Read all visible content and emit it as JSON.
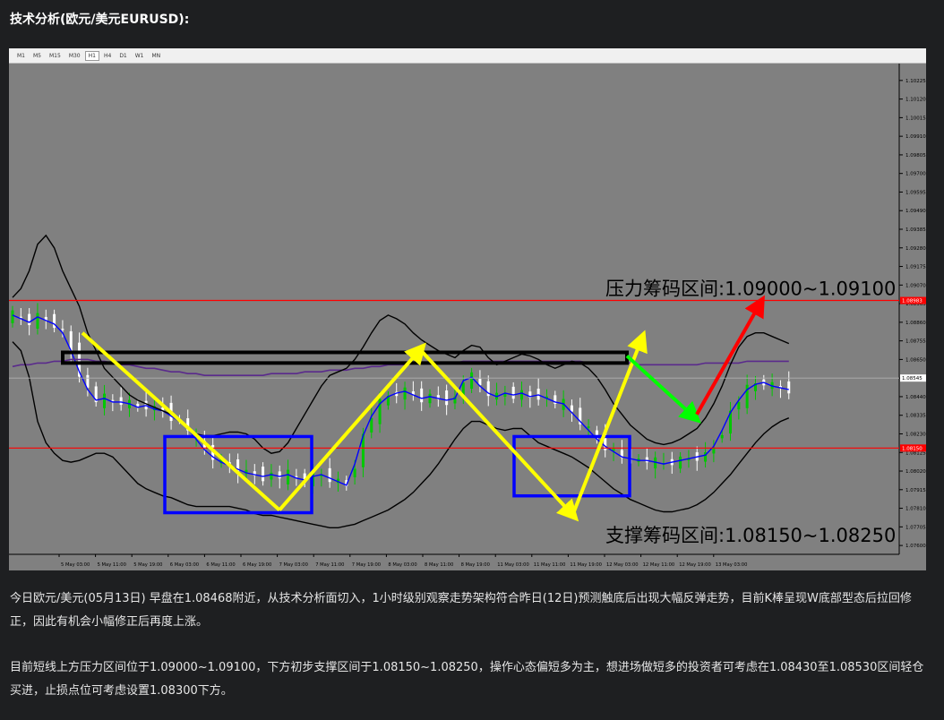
{
  "heading": "技术分析(欧元/美元EURUSD):",
  "timeframes": [
    "M1",
    "M5",
    "M15",
    "M30",
    "H1",
    "H4",
    "D1",
    "W1",
    "MN"
  ],
  "active_timeframe": "H1",
  "paragraphs": [
    "今日欧元/美元(05月13日) 早盘在1.08468附近，从技术分析面切入，1小时级别观察走势架构符合昨日(12日)预测触底后出现大幅反弹走势，目前K棒呈现W底部型态后拉回修正，因此有机会小幅修正后再度上涨。",
    "目前短线上方压力区间位于1.09000~1.09100，下方初步支撑区间于1.08150~1.08250，操作心态偏短多为主，想进场做短多的投资者可考虑在1.08430至1.08530区间轻仓买进，止损点位可考虑设置1.08300下方。"
  ],
  "chart_data": {
    "type": "line",
    "instrument": "EURUSD",
    "timeframe": "H1",
    "ylim": [
      1.0755,
      1.103
    ],
    "y_ticks": [
      "1.10225",
      "1.10120",
      "1.10015",
      "1.09910",
      "1.09805",
      "1.09700",
      "1.09595",
      "1.09490",
      "1.09385",
      "1.09280",
      "1.09175",
      "1.09070",
      "1.08965",
      "1.08860",
      "1.08755",
      "1.08650",
      "1.08545",
      "1.08440",
      "1.08335",
      "1.08230",
      "1.08125",
      "1.08020",
      "1.07915",
      "1.07810",
      "1.07705",
      "1.07600"
    ],
    "x_ticks": [
      "5 May 03:00",
      "5 May 11:00",
      "5 May 19:00",
      "6 May 03:00",
      "6 May 11:00",
      "6 May 19:00",
      "7 May 03:00",
      "7 May 11:00",
      "7 May 19:00",
      "8 May 03:00",
      "8 May 11:00",
      "8 May 19:00",
      "11 May 03:00",
      "11 May 11:00",
      "11 May 19:00",
      "12 May 03:00",
      "12 May 11:00",
      "12 May 19:00",
      "13 May 03:00"
    ],
    "current_price": "1.08545",
    "resistance_line_label": "1.08983",
    "support_line_label": "1.08150",
    "annotations": {
      "resistance_text": "压力筹码区间:1.09000~1.09100",
      "support_text": "支撑筹码区间:1.08150~1.08250"
    },
    "colors": {
      "background": "#808080",
      "bull_candle": "#00c800",
      "bear_candle": "#ffffff",
      "bollinger": "#000000",
      "fast_ma": "#0000ff",
      "slow_ma": "#5a2a8c",
      "horizontal_lines": "#ff0000",
      "wave_arrows": "#ffff00",
      "up_arrow": "#ff0000",
      "down_arrow": "#00ff00",
      "boxes": "#0000ff",
      "top_box": "#000000"
    },
    "series": [
      {
        "values": [
          1.089,
          1.0888,
          1.0886,
          1.0889,
          1.0887,
          1.0885,
          1.088,
          1.087,
          1.0858,
          1.0848,
          1.0842,
          1.0843,
          1.0841,
          1.0841,
          1.084,
          1.0838,
          1.0839,
          1.0837,
          1.0836,
          1.0833,
          1.083,
          1.0826,
          1.082,
          1.0814,
          1.081,
          1.0807,
          1.0805,
          1.0803,
          1.0801,
          1.08,
          1.0799,
          1.08,
          1.0799,
          1.08,
          1.0798,
          1.0797,
          1.0799,
          1.08,
          1.0798,
          1.0796,
          1.0794,
          1.0806,
          1.0822,
          1.0833,
          1.084,
          1.0844,
          1.0846,
          1.0847,
          1.0845,
          1.0843,
          1.0844,
          1.0843,
          1.0842,
          1.0843,
          1.0853,
          1.0855,
          1.085,
          1.0846,
          1.0844,
          1.0846,
          1.0845,
          1.0846,
          1.0844,
          1.0845,
          1.0843,
          1.0841,
          1.084,
          1.0835,
          1.083,
          1.0825,
          1.082,
          1.0816,
          1.0813,
          1.081,
          1.0809,
          1.0808,
          1.0808,
          1.0807,
          1.0806,
          1.0807,
          1.0808,
          1.0809,
          1.081,
          1.0811,
          1.0816,
          1.0825,
          1.0835,
          1.0842,
          1.0848,
          1.0851,
          1.0852,
          1.085,
          1.0849,
          1.0848
        ]
      },
      {
        "values": [
          1.0861,
          1.0862,
          1.0862,
          1.0863,
          1.0863,
          1.0864,
          1.0864,
          1.0865,
          1.0865,
          1.0865,
          1.0864,
          1.0864,
          1.0863,
          1.0862,
          1.0862,
          1.0861,
          1.086,
          1.086,
          1.0859,
          1.0858,
          1.0858,
          1.0857,
          1.0857,
          1.0856,
          1.0856,
          1.0856,
          1.0856,
          1.0856,
          1.0856,
          1.0856,
          1.0856,
          1.0857,
          1.0857,
          1.0857,
          1.0857,
          1.0858,
          1.0858,
          1.0858,
          1.0859,
          1.0859,
          1.0859,
          1.086,
          1.086,
          1.0861,
          1.0861,
          1.0862,
          1.0862,
          1.0862,
          1.0863,
          1.0863,
          1.0863,
          1.0863,
          1.0863,
          1.0863,
          1.0864,
          1.0864,
          1.0864,
          1.0864,
          1.0864,
          1.0864,
          1.0864,
          1.0864,
          1.0864,
          1.0864,
          1.0864,
          1.0864,
          1.0864,
          1.0864,
          1.0864,
          1.0863,
          1.0863,
          1.0863,
          1.0863,
          1.0863,
          1.0863,
          1.0862,
          1.0862,
          1.0862,
          1.0862,
          1.0862,
          1.0862,
          1.0862,
          1.0862,
          1.0863,
          1.0863,
          1.0863,
          1.0863,
          1.0863,
          1.0864,
          1.0864,
          1.0864,
          1.0864,
          1.0864,
          1.0864
        ]
      },
      {
        "values": [
          1.09,
          1.0905,
          1.0915,
          1.093,
          1.0935,
          1.0928,
          1.0915,
          1.0905,
          1.0895,
          1.088,
          1.087,
          1.086,
          1.0855,
          1.085,
          1.0845,
          1.0842,
          1.084,
          1.0838,
          1.0836,
          1.0834,
          1.083,
          1.0826,
          1.0823,
          1.0822,
          1.0822,
          1.0823,
          1.0824,
          1.0824,
          1.0823,
          1.082,
          1.0815,
          1.0812,
          1.0813,
          1.0818,
          1.0826,
          1.0834,
          1.0842,
          1.085,
          1.0856,
          1.0858,
          1.086,
          1.0865,
          1.0872,
          1.088,
          1.0887,
          1.089,
          1.0888,
          1.0885,
          1.088,
          1.0876,
          1.0873,
          1.087,
          1.0868,
          1.0866,
          1.087,
          1.0873,
          1.0872,
          1.0866,
          1.0862,
          1.0864,
          1.0866,
          1.0868,
          1.0867,
          1.0865,
          1.0862,
          1.086,
          1.0862,
          1.0864,
          1.0863,
          1.086,
          1.0855,
          1.0848,
          1.084,
          1.0834,
          1.0828,
          1.0824,
          1.082,
          1.0818,
          1.0817,
          1.0818,
          1.082,
          1.0823,
          1.0826,
          1.0832,
          1.084,
          1.085,
          1.0862,
          1.0872,
          1.0878,
          1.088,
          1.088,
          1.0878,
          1.0876,
          1.0874
        ]
      },
      {
        "values": [
          1.0875,
          1.087,
          1.0855,
          1.083,
          1.0818,
          1.0812,
          1.0808,
          1.0807,
          1.0808,
          1.081,
          1.0812,
          1.0812,
          1.081,
          1.0805,
          1.08,
          1.0795,
          1.0792,
          1.079,
          1.0788,
          1.0787,
          1.0785,
          1.0783,
          1.0782,
          1.0782,
          1.0782,
          1.0782,
          1.0782,
          1.0781,
          1.078,
          1.0778,
          1.0777,
          1.0777,
          1.0776,
          1.0775,
          1.0774,
          1.0773,
          1.0772,
          1.0771,
          1.077,
          1.077,
          1.0771,
          1.0772,
          1.0774,
          1.0776,
          1.0778,
          1.078,
          1.0783,
          1.0786,
          1.079,
          1.0795,
          1.08,
          1.0806,
          1.0813,
          1.082,
          1.0826,
          1.083,
          1.083,
          1.0828,
          1.0826,
          1.0825,
          1.0826,
          1.0826,
          1.0822,
          1.0818,
          1.0816,
          1.0814,
          1.0812,
          1.081,
          1.0807,
          1.0804,
          1.08,
          1.0796,
          1.0792,
          1.0789,
          1.0786,
          1.0784,
          1.0782,
          1.078,
          1.0779,
          1.0779,
          1.078,
          1.0781,
          1.0783,
          1.0786,
          1.079,
          1.0795,
          1.08,
          1.0806,
          1.0812,
          1.0818,
          1.0823,
          1.0827,
          1.083,
          1.0832
        ]
      }
    ]
  }
}
